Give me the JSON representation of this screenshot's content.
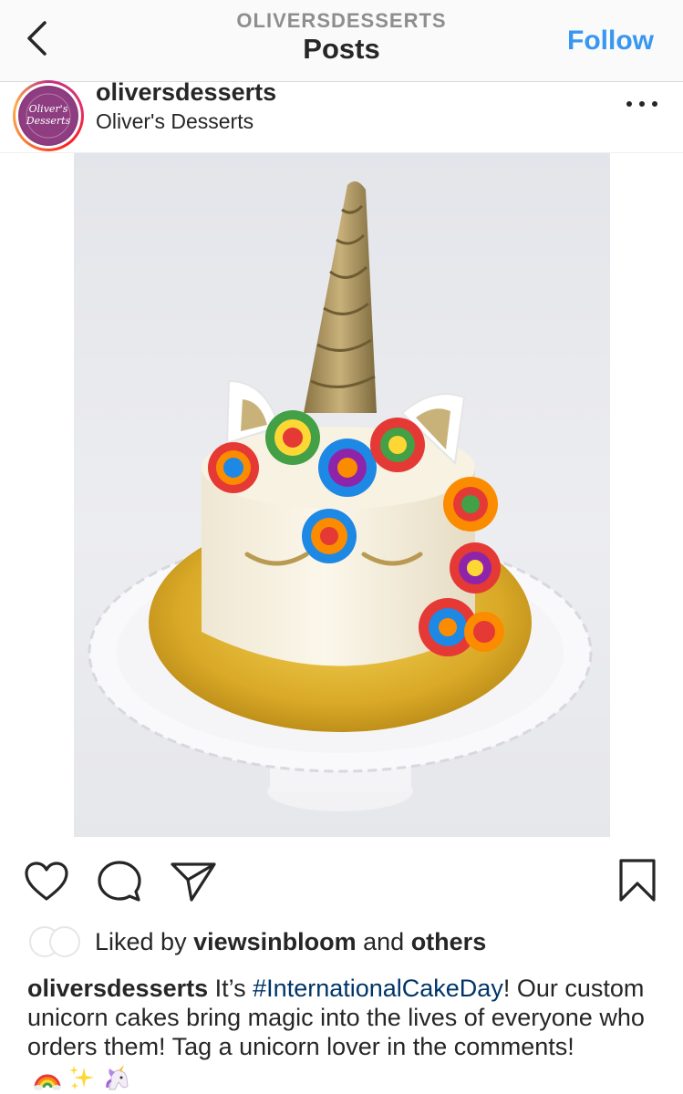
{
  "header": {
    "account_caps": "OLIVERSDESSERTS",
    "title": "Posts",
    "follow_label": "Follow"
  },
  "post": {
    "username": "oliversdesserts",
    "display_name": "Oliver's Desserts",
    "avatar_text_line1": "Oliver's",
    "avatar_text_line2": "Desserts"
  },
  "likes": {
    "prefix": "Liked by ",
    "liker": "viewsinbloom",
    "joiner": " and ",
    "others": "others"
  },
  "caption": {
    "username": "oliversdesserts",
    "text_before": " It’s ",
    "hashtag": "#InternationalCakeDay",
    "text_after": "! Our custom unicorn cakes bring magic into the lives of everyone who orders them! Tag a unicorn lover in the comments!",
    "emojis": [
      "rainbow-emoji",
      "sparkles-emoji",
      "unicorn-emoji"
    ]
  },
  "colors": {
    "follow_blue": "#3897f0",
    "hashtag_blue": "#003569",
    "text": "#262626",
    "muted": "#8e8e8e"
  }
}
